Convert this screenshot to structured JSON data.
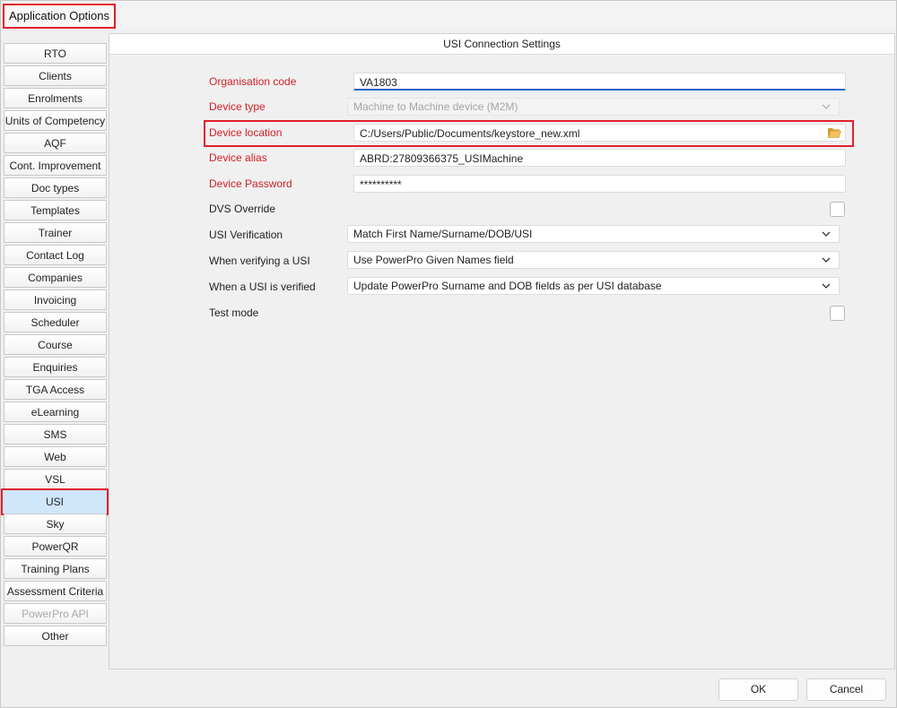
{
  "window": {
    "title": "Application Options"
  },
  "sidebar": {
    "items": [
      {
        "label": "RTO"
      },
      {
        "label": "Clients"
      },
      {
        "label": "Enrolments"
      },
      {
        "label": "Units of Competency"
      },
      {
        "label": "AQF"
      },
      {
        "label": "Cont. Improvement"
      },
      {
        "label": "Doc types"
      },
      {
        "label": "Templates"
      },
      {
        "label": "Trainer"
      },
      {
        "label": "Contact Log"
      },
      {
        "label": "Companies"
      },
      {
        "label": "Invoicing"
      },
      {
        "label": "Scheduler"
      },
      {
        "label": "Course"
      },
      {
        "label": "Enquiries"
      },
      {
        "label": "TGA Access"
      },
      {
        "label": "eLearning"
      },
      {
        "label": "SMS"
      },
      {
        "label": "Web"
      },
      {
        "label": "VSL"
      },
      {
        "label": "USI"
      },
      {
        "label": "Sky"
      },
      {
        "label": "PowerQR"
      },
      {
        "label": "Training Plans"
      },
      {
        "label": "Assessment Criteria"
      },
      {
        "label": "PowerPro API"
      },
      {
        "label": "Other"
      }
    ],
    "active": "USI",
    "disabled": "PowerPro API"
  },
  "panel": {
    "title": "USI Connection Settings",
    "fields": {
      "org_code": {
        "label": "Organisation code",
        "value": "VA1803"
      },
      "device_type": {
        "label": "Device type",
        "value": "Machine to Machine device (M2M)"
      },
      "device_location": {
        "label": "Device location",
        "value": "C:/Users/Public/Documents/keystore_new.xml"
      },
      "device_alias": {
        "label": "Device alias",
        "value": "ABRD:27809366375_USIMachine"
      },
      "device_password": {
        "label": "Device Password",
        "value": "**********"
      },
      "dvs_override": {
        "label": "DVS Override",
        "checked": false
      },
      "usi_verification": {
        "label": "USI Verification",
        "value": "Match First Name/Surname/DOB/USI"
      },
      "verifying_usi": {
        "label": "When verifying a USI",
        "value": "Use PowerPro Given Names field"
      },
      "usi_verified": {
        "label": "When a USI is verified",
        "value": "Update PowerPro Surname and DOB fields as per USI database"
      },
      "test_mode": {
        "label": "Test mode",
        "checked": false
      }
    }
  },
  "footer": {
    "ok_label": "OK",
    "cancel_label": "Cancel"
  },
  "colors": {
    "required": "#d21f26",
    "highlight": "#e0202a",
    "active_bg": "#cfe6fb",
    "focus": "#2a62c9",
    "folder": "#e6a63a"
  },
  "icons": {
    "browse": "folder-open-icon",
    "dropdown": "chevron-down-icon"
  }
}
